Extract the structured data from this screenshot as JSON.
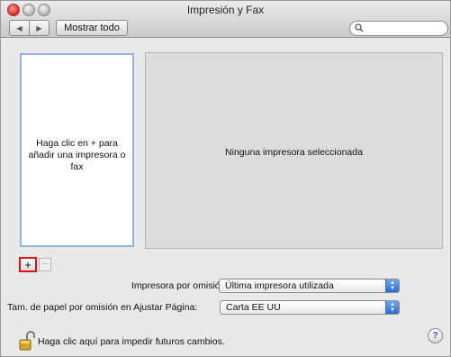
{
  "window": {
    "title": "Impresión y Fax",
    "toolbar": {
      "back_label": "◀",
      "forward_label": "▶",
      "show_all_label": "Mostrar todo",
      "search_placeholder": ""
    }
  },
  "printer_list": {
    "empty_hint": "Haga clic en + para añadir una impresora o fax"
  },
  "detail_panel": {
    "message": "Ninguna impresora seleccionada"
  },
  "list_buttons": {
    "add_label": "+",
    "remove_label": "−"
  },
  "settings": {
    "default_printer_label": "Impresora por omisión:",
    "default_printer_value": "Última impresora utilizada",
    "default_paper_label": "Tam. de papel por omisión en Ajustar Página:",
    "default_paper_value": "Carta EE UU"
  },
  "footer": {
    "lock_text": "Haga clic aquí para impedir futuros cambios.",
    "help_label": "?"
  },
  "colors": {
    "highlight_box": "#e01010",
    "list_focus_ring": "#92b5e0",
    "popup_accent": "#2a6fd0"
  },
  "icons": [
    "close-icon",
    "minimize-icon",
    "zoom-icon",
    "search-icon",
    "lock-icon",
    "help-icon",
    "popup-arrows-icon"
  ]
}
